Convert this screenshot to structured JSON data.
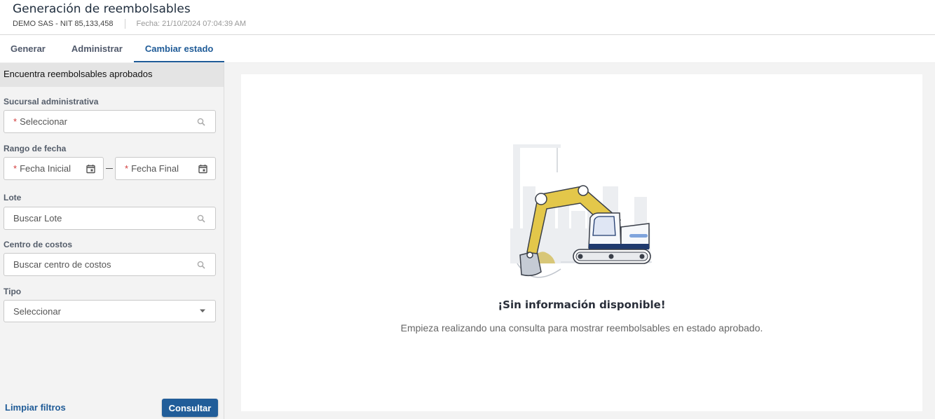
{
  "header": {
    "title": "Generación de reembolsables",
    "company": "DEMO SAS - NIT 85,133,458",
    "date": "Fecha: 21/10/2024 07:04:39 AM"
  },
  "tabs": [
    {
      "label": "Generar",
      "active": false
    },
    {
      "label": "Administrar",
      "active": false
    },
    {
      "label": "Cambiar estado",
      "active": true
    }
  ],
  "sidebar": {
    "title": "Encuentra reembolsables aprobados",
    "sucursal": {
      "label": "Sucursal administrativa",
      "placeholder": "Seleccionar",
      "required_mark": "*"
    },
    "rango": {
      "label": "Rango de fecha",
      "start_placeholder": "Fecha Inicial",
      "end_placeholder": "Fecha Final",
      "required_mark": "*"
    },
    "lote": {
      "label": "Lote",
      "placeholder": "Buscar Lote"
    },
    "centro": {
      "label": "Centro de costos",
      "placeholder": "Buscar centro de costos"
    },
    "tipo": {
      "label": "Tipo",
      "value": "Seleccionar"
    },
    "clear_label": "Limpiar filtros",
    "query_label": "Consultar"
  },
  "main": {
    "empty_title": "¡Sin información disponible!",
    "empty_subtitle": "Empieza realizando una consulta para mostrar reembolsables en estado aprobado."
  },
  "colors": {
    "accent": "#215d99",
    "required": "#d23b3b",
    "excavator_arm": "#e3c74a"
  },
  "icons": [
    "search-icon",
    "calendar-icon",
    "caret-down-icon",
    "excavator-illustration"
  ]
}
